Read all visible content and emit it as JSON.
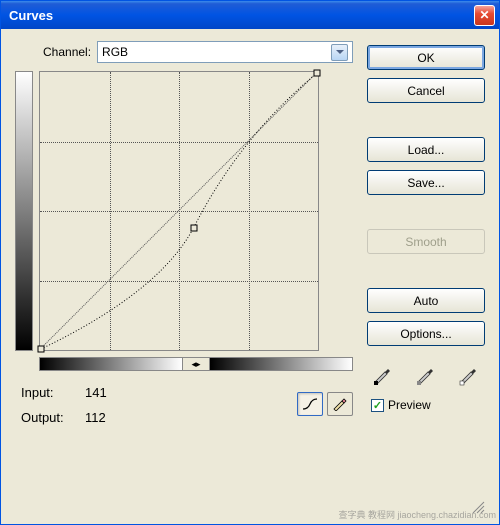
{
  "window": {
    "title": "Curves"
  },
  "channel": {
    "label": "Channel:",
    "value": "RGB"
  },
  "io": {
    "input_label": "Input:",
    "input_value": "141",
    "output_label": "Output:",
    "output_value": "112"
  },
  "buttons": {
    "ok": "OK",
    "cancel": "Cancel",
    "load": "Load...",
    "save": "Save...",
    "smooth": "Smooth",
    "auto": "Auto",
    "options": "Options..."
  },
  "preview": {
    "checked": true,
    "label": "Preview"
  },
  "chart_data": {
    "type": "line",
    "title": "Curves",
    "xlabel": "Input",
    "ylabel": "Output",
    "xlim": [
      0,
      255
    ],
    "ylim": [
      0,
      255
    ],
    "grid": true,
    "series": [
      {
        "name": "RGB",
        "points": [
          {
            "x": 0,
            "y": 0
          },
          {
            "x": 141,
            "y": 112
          },
          {
            "x": 255,
            "y": 255
          }
        ]
      }
    ]
  },
  "watermark": "查字典 教程网 jiaocheng.chazidian.com"
}
